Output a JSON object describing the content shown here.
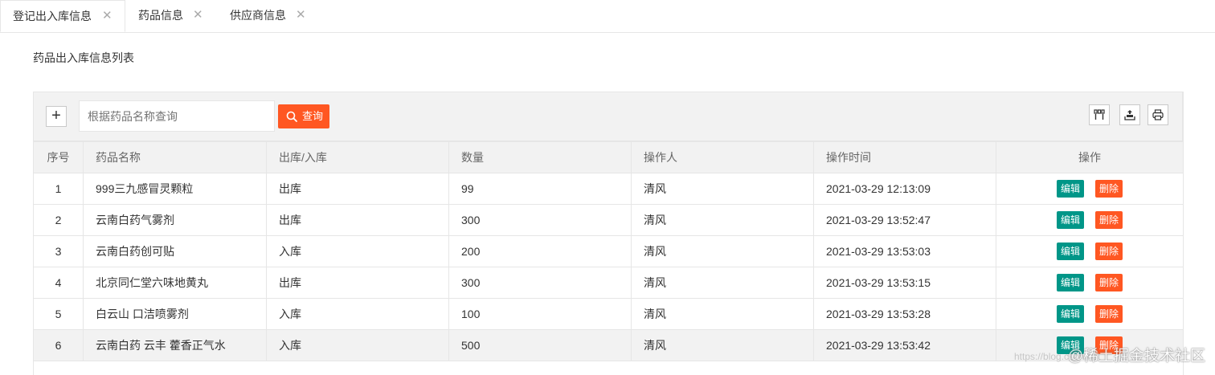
{
  "tabs": [
    {
      "label": "登记出入库信息",
      "close": "✕",
      "active": true
    },
    {
      "label": "药品信息",
      "close": "✕",
      "active": false
    },
    {
      "label": "供应商信息",
      "close": "✕",
      "active": false
    }
  ],
  "page_title": "药品出入库信息列表",
  "toolbar": {
    "add_label": "+",
    "search_placeholder": "根据药品名称查询",
    "search_value": "",
    "query_label": "查询",
    "tool_icons": [
      "columns-icon",
      "export-icon",
      "print-icon"
    ]
  },
  "table": {
    "headers": [
      "序号",
      "药品名称",
      "出库/入库",
      "数量",
      "操作人",
      "操作时间",
      "操作"
    ],
    "rows": [
      {
        "seq": "1",
        "name": "999三九感冒灵颗粒",
        "type": "出库",
        "qty": "99",
        "operator": "清风",
        "time": "2021-03-29 12:13:09"
      },
      {
        "seq": "2",
        "name": "云南白药气雾剂",
        "type": "出库",
        "qty": "300",
        "operator": "清风",
        "time": "2021-03-29 13:52:47"
      },
      {
        "seq": "3",
        "name": "云南白药创可贴",
        "type": "入库",
        "qty": "200",
        "operator": "清风",
        "time": "2021-03-29 13:53:03"
      },
      {
        "seq": "4",
        "name": "北京同仁堂六味地黄丸",
        "type": "出库",
        "qty": "300",
        "operator": "清风",
        "time": "2021-03-29 13:53:15"
      },
      {
        "seq": "5",
        "name": "白云山 口洁喷雾剂",
        "type": "入库",
        "qty": "100",
        "operator": "清风",
        "time": "2021-03-29 13:53:28"
      },
      {
        "seq": "6",
        "name": "云南白药 云丰 藿香正气水",
        "type": "入库",
        "qty": "500",
        "operator": "清风",
        "time": "2021-03-29 13:53:42"
      }
    ],
    "edit_label": "编辑",
    "delete_label": "删除"
  },
  "watermark": "@稀土掘金技术社区",
  "watermark_url": "https://blog.csdn.net",
  "colors": {
    "primary": "#009688",
    "danger": "#ff5722",
    "header_bg": "#f2f2f2",
    "border": "#e6e6e6"
  }
}
